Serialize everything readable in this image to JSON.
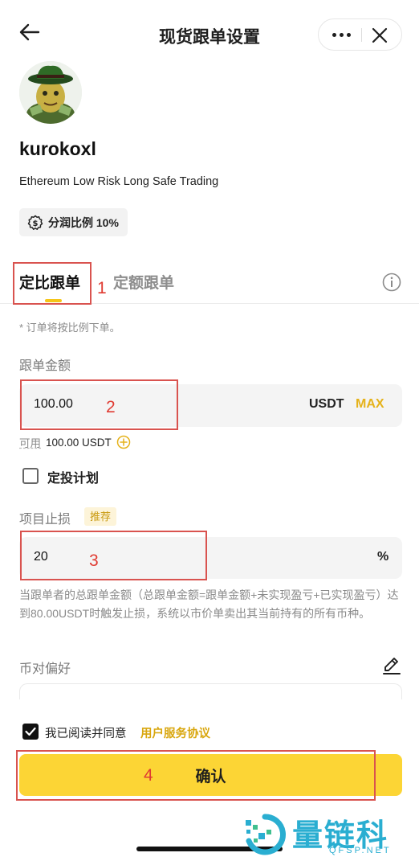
{
  "header": {
    "title": "现货跟单设置",
    "back_icon": "arrow-left-icon",
    "more_icon": "more-dots-icon",
    "close_icon": "close-icon"
  },
  "trader": {
    "name": "kurokoxl",
    "description": "Ethereum Low Risk Long Safe Trading",
    "profit_share_label": "分润比例 10%"
  },
  "tabs": [
    {
      "label": "定比跟单",
      "active": true
    },
    {
      "label": "定额跟单",
      "active": false
    }
  ],
  "tip": "* 订单将按比例下单。",
  "copy_amount": {
    "label": "跟单金额",
    "value": "100.00",
    "unit": "USDT",
    "max_label": "MAX",
    "available_label": "可用",
    "available_value": "100.00 USDT"
  },
  "dca_plan": {
    "label": "定投计划",
    "checked": false
  },
  "stop_loss": {
    "label": "项目止损",
    "badge": "推荐",
    "value": "20",
    "unit": "%",
    "description": "当跟单者的总跟单金额（总跟单金额=跟单金额+未实现盈亏+已实现盈亏）达到80.00USDT时触发止损，系统以市价单卖出其当前持有的所有币种。"
  },
  "pair_preference": {
    "label": "币对偏好"
  },
  "agreement": {
    "text": "我已阅读并同意",
    "link": "用户服务协议",
    "checked": true
  },
  "confirm_label": "确认",
  "annotations": [
    "1",
    "2",
    "3",
    "4"
  ],
  "watermark": {
    "text": "量链科技",
    "sub": "QFSP.NET"
  },
  "colors": {
    "accent": "#fcd535",
    "max": "#e5b21a",
    "annotation": "#d9534f"
  }
}
